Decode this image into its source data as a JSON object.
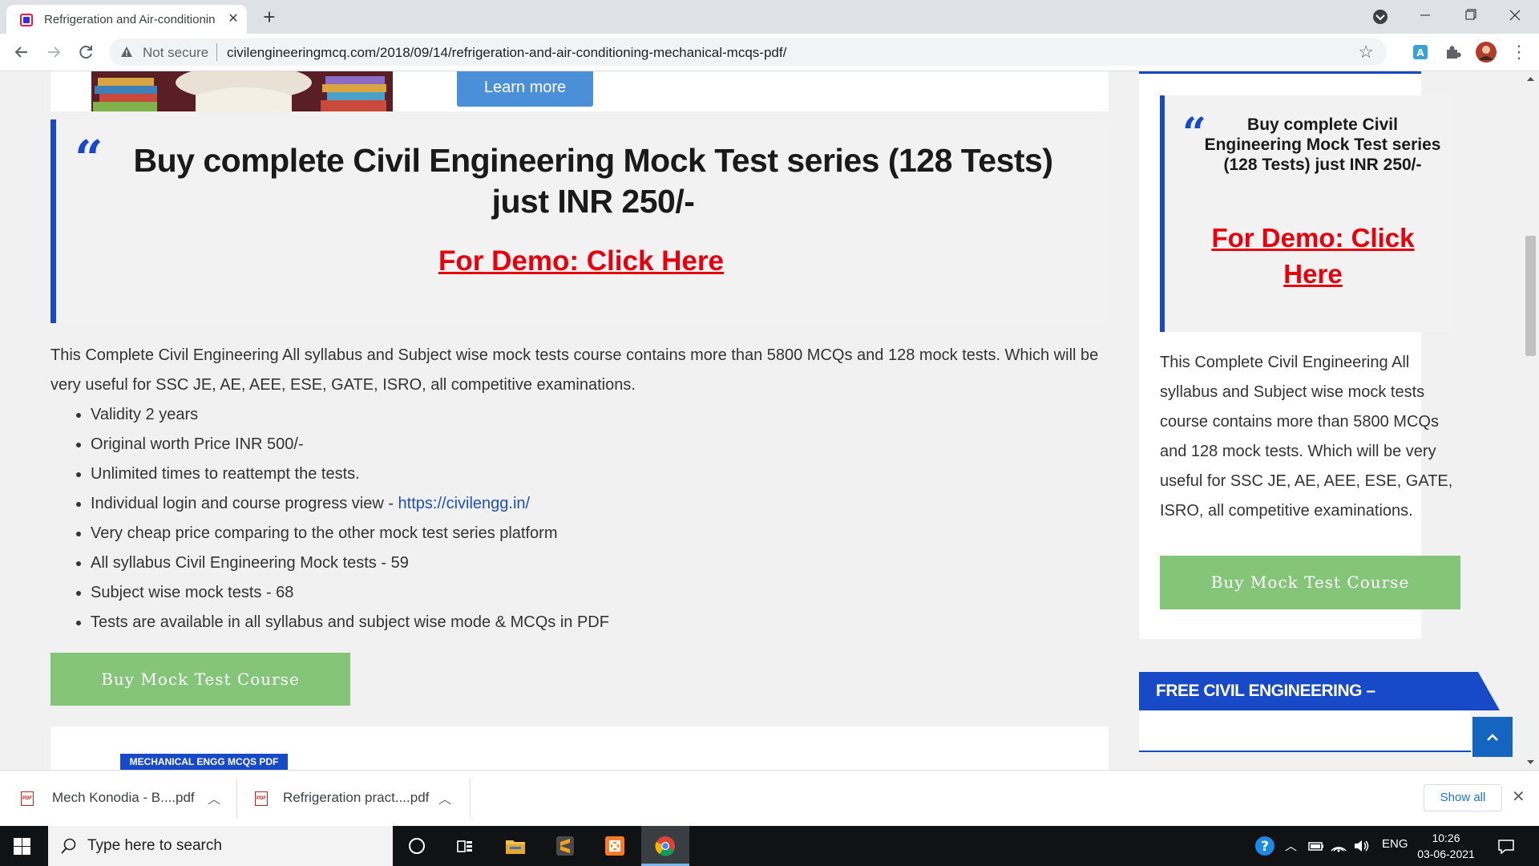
{
  "browser": {
    "tab_title": "Refrigeration and Air-conditionin",
    "new_tab_symbol": "+",
    "security_label": "Not secure",
    "url": "civilengineeringmcq.com/2018/09/14/refrigeration-and-air-conditioning-mechanical-mcqs-pdf/"
  },
  "page": {
    "ad_button": "Learn more",
    "promo_title": "Buy complete Civil Engineering Mock Test series (128 Tests) just INR 250/-",
    "demo_link": "For Demo: Click Here",
    "description": "This Complete Civil Engineering All syllabus and Subject wise mock tests course contains more than 5800 MCQs and 128 mock tests. Which will be very useful for SSC JE, AE, AEE, ESE, GATE, ISRO, all competitive examinations.",
    "bullets": [
      "Validity 2 years",
      "Original worth Price INR 500/-",
      "Unlimited times to reattempt the tests.",
      "Individual login and course progress view - ",
      "Very cheap price comparing to the other mock test series platform",
      "All syllabus Civil Engineering Mock tests - 59",
      "Subject wise mock tests - 68",
      "Tests are available in all syllabus and subject wise mode & MCQs in PDF"
    ],
    "bullet_link": "https://civilengg.in/",
    "buy_button": "Buy Mock Test Course",
    "category_badge": "MECHANICAL ENGG MCQS PDF"
  },
  "sidebar": {
    "promo_title": "Buy complete Civil Engineering Mock Test series (128 Tests) just INR 250/-",
    "demo_link": "For Demo: Click Here",
    "description": "This Complete Civil Engineering All syllabus and Subject wise mock tests course contains more than 5800 MCQs and 128 mock tests. Which will be very useful for SSC JE, AE, AEE, ESE, GATE, ISRO, all competitive examinations.",
    "buy_button": "Buy Mock Test Course",
    "free_heading": "FREE CIVIL ENGINEERING –"
  },
  "downloads": {
    "items": [
      "Mech Konodia - B....pdf",
      "Refrigeration pract....pdf"
    ],
    "show_all": "Show all"
  },
  "taskbar": {
    "search_placeholder": "Type here to search",
    "language": "ENG",
    "time": "10:26",
    "date": "03-06-2021"
  },
  "colors": {
    "accent_blue": "#1849c7",
    "link_red": "#e6020d",
    "button_green": "#85c57a"
  }
}
